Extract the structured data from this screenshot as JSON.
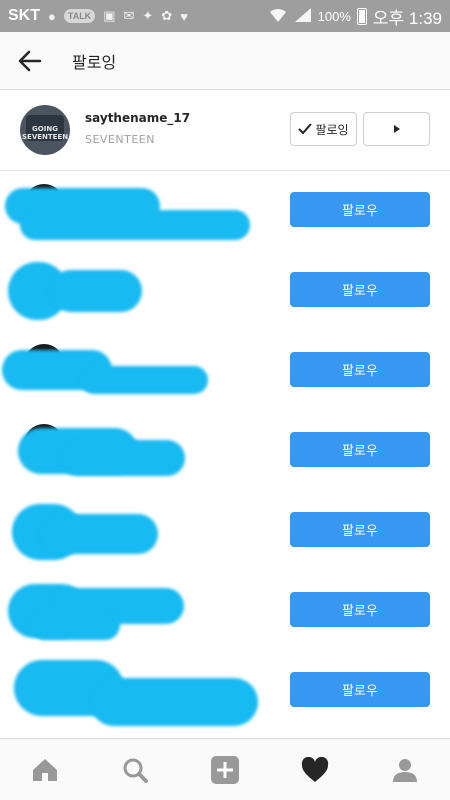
{
  "status_bar": {
    "carrier": "SKT",
    "talk_badge": "TALK",
    "battery": "100%",
    "time": "오후 1:39"
  },
  "header": {
    "title": "팔로잉"
  },
  "top_user": {
    "username": "saythename_17",
    "fullname": "SEVENTEEN",
    "avatar_text": "GOING SEVENTEEN",
    "following_label": "팔로잉"
  },
  "rows": [
    {
      "follow_label": "팔로우"
    },
    {
      "follow_label": "팔로우"
    },
    {
      "follow_label": "팔로우"
    },
    {
      "follow_label": "팔로우"
    },
    {
      "follow_label": "팔로우"
    },
    {
      "follow_label": "팔로우"
    },
    {
      "follow_label": "팔로우"
    }
  ],
  "nav": [
    "home-icon",
    "search-icon",
    "add-icon",
    "activity-heart-icon",
    "profile-icon"
  ],
  "colors": {
    "accent": "#3897f0",
    "redaction": "#17baf1"
  }
}
